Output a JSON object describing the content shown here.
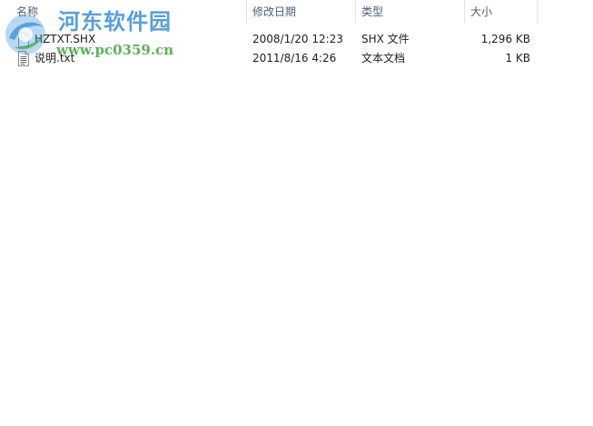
{
  "columns": {
    "name": "名称",
    "date": "修改日期",
    "type": "类型",
    "size": "大小"
  },
  "sort": {
    "indicator": "^",
    "icon": "sort-ascending-icon"
  },
  "files": [
    {
      "name": "HZTXT.SHX",
      "date": "2008/1/20 12:23",
      "type": "SHX 文件",
      "size": "1,296 KB",
      "icon": "generic-file-icon"
    },
    {
      "name": "说明.txt",
      "date": "2011/8/16 4:26",
      "type": "文本文档",
      "size": "1 KB",
      "icon": "text-document-icon"
    }
  ],
  "watermark": {
    "title": "河东软件园",
    "url": "www.pc0359.cn",
    "title_color": "#3a8fd6",
    "url_color": "#3aa838",
    "icon": "pc0359-logo-icon"
  }
}
